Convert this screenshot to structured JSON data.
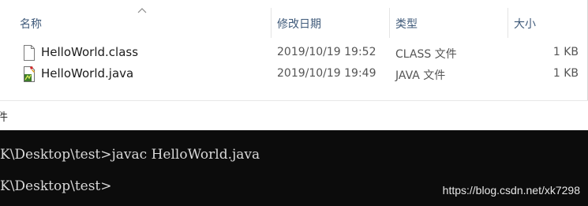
{
  "explorer": {
    "columns": {
      "name": "名称",
      "modified": "修改日期",
      "type": "类型",
      "size": "大小"
    },
    "sort_indicator": "chevron-up-icon",
    "files": [
      {
        "icon": "generic-file-icon",
        "name": "HelloWorld.class",
        "modified": "2019/10/19 19:52",
        "type": "CLASS 文件",
        "size": "1 KB"
      },
      {
        "icon": "java-file-icon",
        "name": "HelloWorld.java",
        "modified": "2019/10/19 19:49",
        "type": "JAVA 文件",
        "size": "1 KB"
      }
    ]
  },
  "strip": {
    "fragment": "件"
  },
  "console": {
    "lines": [
      "K\\Desktop\\test>javac HelloWorld.java",
      "K\\Desktop\\test>"
    ]
  },
  "watermark": "https://blog.csdn.net/xk7298"
}
